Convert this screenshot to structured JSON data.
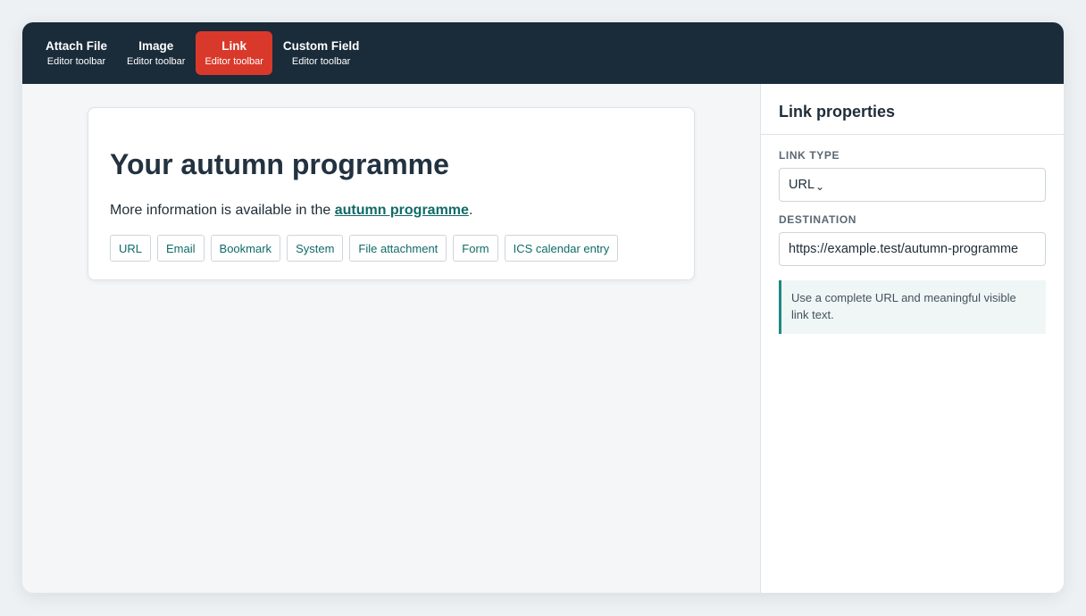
{
  "toolbar": {
    "items": [
      {
        "title": "Attach File",
        "subtitle": "Editor toolbar"
      },
      {
        "title": "Image",
        "subtitle": "Editor toolbar"
      },
      {
        "title": "Link",
        "subtitle": "Editor toolbar",
        "active": true
      },
      {
        "title": "Custom Field",
        "subtitle": "Editor toolbar"
      }
    ],
    "active_color": "#d9392a",
    "background_color": "#1a2b3a"
  },
  "editor": {
    "heading": "Your autumn programme",
    "paragraph_before": "More information is available in the ",
    "link_text": "autumn programme",
    "paragraph_after": ".",
    "link_color": "#0f6b68",
    "link_types": [
      "URL",
      "Email",
      "Bookmark",
      "System",
      "File attachment",
      "Form",
      "ICS calendar entry"
    ]
  },
  "panel": {
    "title": "Link properties",
    "link_type_label": "LINK TYPE",
    "link_type_value": "URL",
    "chevron_icon": "chevron-down-icon",
    "destination_label": "DESTINATION",
    "destination_value": "https://example.test/autumn-programme",
    "note": "Use a complete URL and meaningful visible link text.",
    "note_accent": "#1a8a82"
  }
}
